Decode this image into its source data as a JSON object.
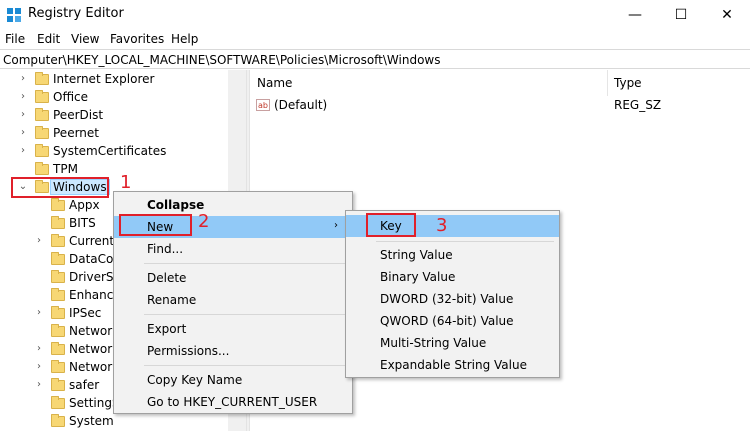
{
  "window": {
    "title": "Registry Editor",
    "minimize": "—",
    "maximize": "☐",
    "close": "✕"
  },
  "menu": [
    "File",
    "Edit",
    "View",
    "Favorites",
    "Help"
  ],
  "address": "Computer\\HKEY_LOCAL_MACHINE\\SOFTWARE\\Policies\\Microsoft\\Windows",
  "tree": {
    "top_items": [
      "Internet Explorer",
      "Office",
      "PeerDist",
      "Peernet",
      "SystemCertificates",
      "TPM"
    ],
    "selected": "Windows",
    "children": [
      "Appx",
      "BITS",
      "CurrentV",
      "DataCol",
      "DriverSe",
      "Enhance",
      "IPSec",
      "Network",
      "Network",
      "Network",
      "safer",
      "SettingS",
      "System"
    ]
  },
  "values_pane": {
    "col_name": "Name",
    "col_type": "Type",
    "rows": [
      {
        "icon": "ab",
        "name": "(Default)",
        "type": "REG_SZ"
      }
    ]
  },
  "context_menu": {
    "items": [
      "Collapse",
      "New",
      "Find...",
      "Delete",
      "Rename",
      "Export",
      "Permissions...",
      "Copy Key Name",
      "Go to HKEY_CURRENT_USER"
    ]
  },
  "new_submenu": {
    "items": [
      "Key",
      "String Value",
      "Binary Value",
      "DWORD (32-bit) Value",
      "QWORD (64-bit) Value",
      "Multi-String Value",
      "Expandable String Value"
    ]
  },
  "annotations": [
    "1",
    "2",
    "3"
  ],
  "colors": {
    "annotation": "#e0202a",
    "highlight": "#91c9f7"
  }
}
